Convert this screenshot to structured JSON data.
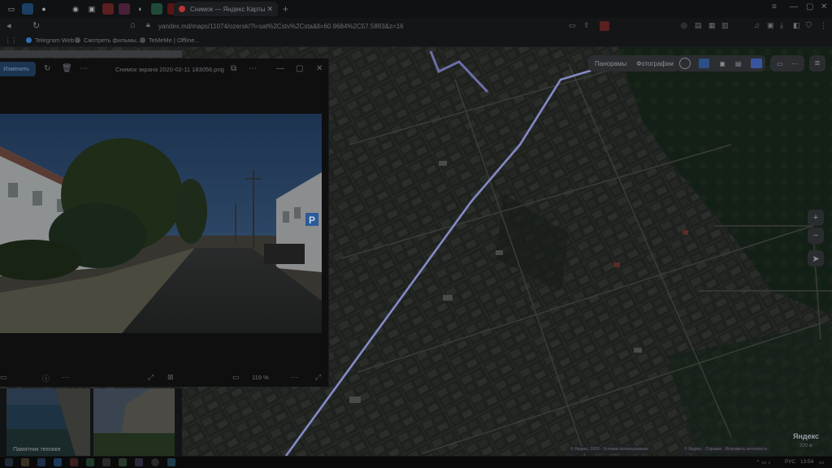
{
  "browser": {
    "tab_title": "Снимок — Яндекс Карты",
    "url": "yandex.md/maps/11074/ozersk/?l=sat%2Cstv%2Csta&ll=60.9684%2C57.5893&z=16",
    "bookmarks": [
      "Telegram Web",
      "Смотреть фильмы...",
      "TeMeMe | Offline..."
    ]
  },
  "viewer": {
    "title": "Снимок экрана 2020-02-11 183056.png",
    "edit_label": "Изменить",
    "zoom_text": "119 %"
  },
  "map": {
    "panorama_label": "Панорамы",
    "photos_label": "Фотографии",
    "zoom_in": "+",
    "zoom_out": "−",
    "logo": "Яндекс",
    "scale": "200 м",
    "copyright_left": "© Яндекс, 2020 · Условия использования",
    "copyright_right": "© Яндекс · Справка · Исправить неточность"
  },
  "thumbs": {
    "label": "Памятник технике"
  },
  "taskbar": {
    "lang": "РУС",
    "time": "13:54"
  }
}
